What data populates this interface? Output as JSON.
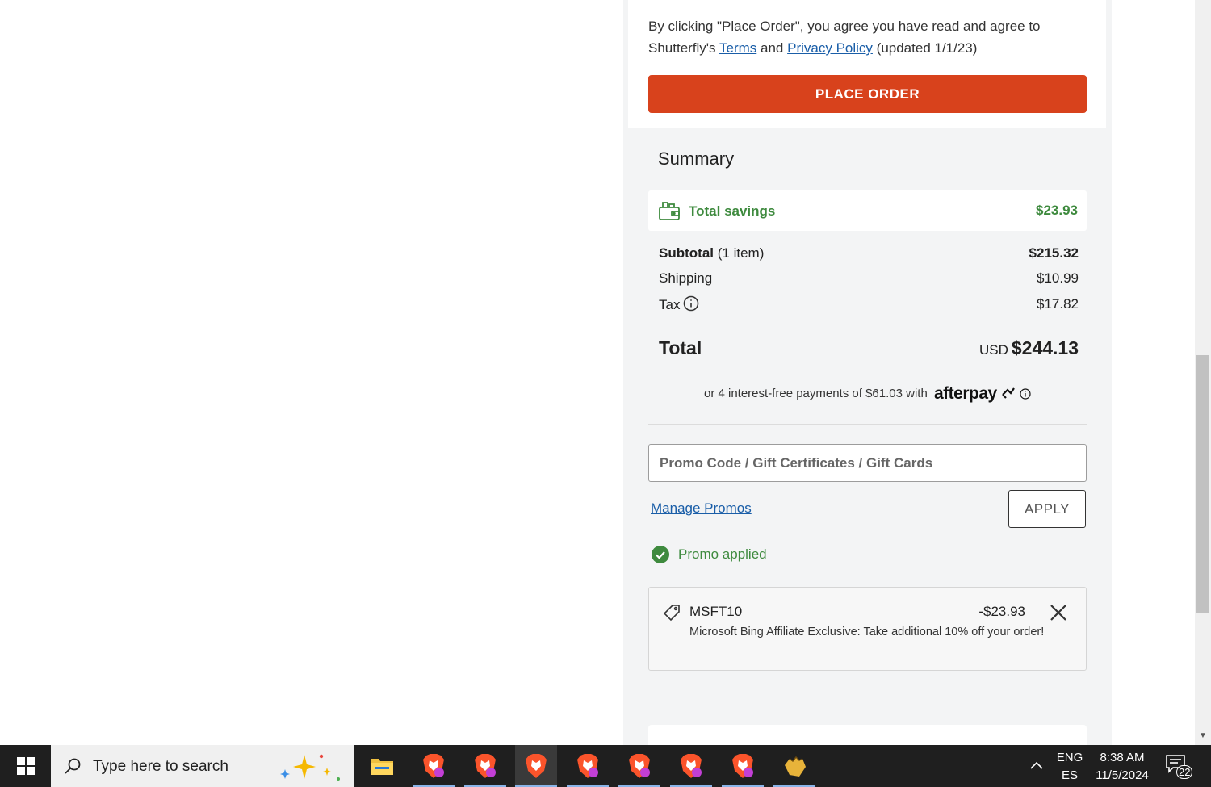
{
  "agreement": {
    "prefix": "By clicking \"Place Order\", you agree you have read and agree to Shutterfly's",
    "terms_link": "Terms",
    "and": "and",
    "privacy_link": "Privacy Policy",
    "suffix": "(updated 1/1/23)"
  },
  "place_order_label": "PLACE ORDER",
  "summary": {
    "title": "Summary",
    "savings_label": "Total savings",
    "savings_value": "$23.93",
    "subtotal_label": "Subtotal",
    "subtotal_count": "(1 item)",
    "subtotal_value": "$215.32",
    "shipping_label": "Shipping",
    "shipping_value": "$10.99",
    "tax_label": "Tax",
    "tax_value": "$17.82",
    "total_label": "Total",
    "total_currency": "USD",
    "total_value": "$244.13"
  },
  "afterpay": {
    "text": "or 4 interest-free payments of $61.03 with",
    "brand": "afterpay"
  },
  "promo": {
    "placeholder": "Promo Code / Gift Certificates / Gift Cards",
    "manage_link": "Manage Promos",
    "apply_label": "APPLY",
    "applied_text": "Promo applied",
    "code": "MSFT10",
    "amount": "-$23.93",
    "description": "Microsoft Bing Affiliate Exclusive: Take additional 10% off your order!"
  },
  "taskbar": {
    "search_placeholder": "Type here to search",
    "lang_top": "ENG",
    "lang_bottom": "ES",
    "time": "8:38 AM",
    "date": "11/5/2024",
    "notification_count": "22",
    "apps": [
      "file-explorer-icon",
      "brave-browser-icon",
      "brave-browser-icon",
      "brave-browser-icon",
      "brave-browser-icon",
      "brave-browser-icon",
      "brave-browser-icon",
      "brave-browser-icon",
      "hand-cursor-app-icon"
    ]
  },
  "colors": {
    "accent": "#d8421c",
    "link": "#1a5ea8",
    "success": "#3e8a3e",
    "panel_bg": "#f3f4f5"
  }
}
